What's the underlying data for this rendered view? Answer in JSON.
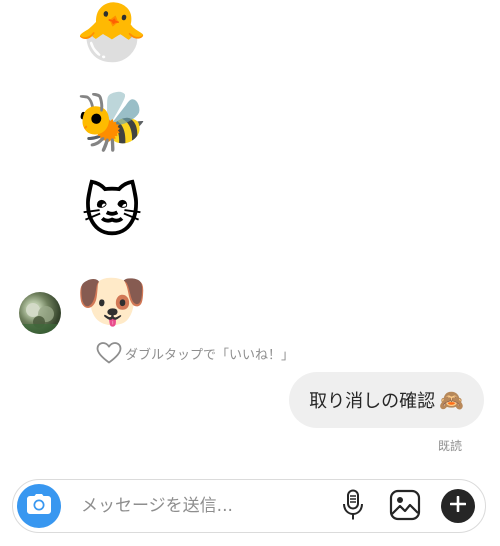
{
  "messages": {
    "emoji_1": "🐣",
    "emoji_2": "🐝",
    "emoji_3": "🐱",
    "emoji_4": "🐶"
  },
  "like_hint": {
    "icon": "heart-outline-icon",
    "text": "ダブルタップで「いいね！」"
  },
  "sent_message": {
    "text": "取り消しの確認",
    "emoji": "🙈",
    "status": "既読"
  },
  "composer": {
    "placeholder": "メッセージを送信...",
    "camera_icon": "camera-icon",
    "mic_icon": "microphone-icon",
    "gallery_icon": "gallery-icon",
    "plus_icon": "plus-icon",
    "accent_color": "#3897f0"
  }
}
